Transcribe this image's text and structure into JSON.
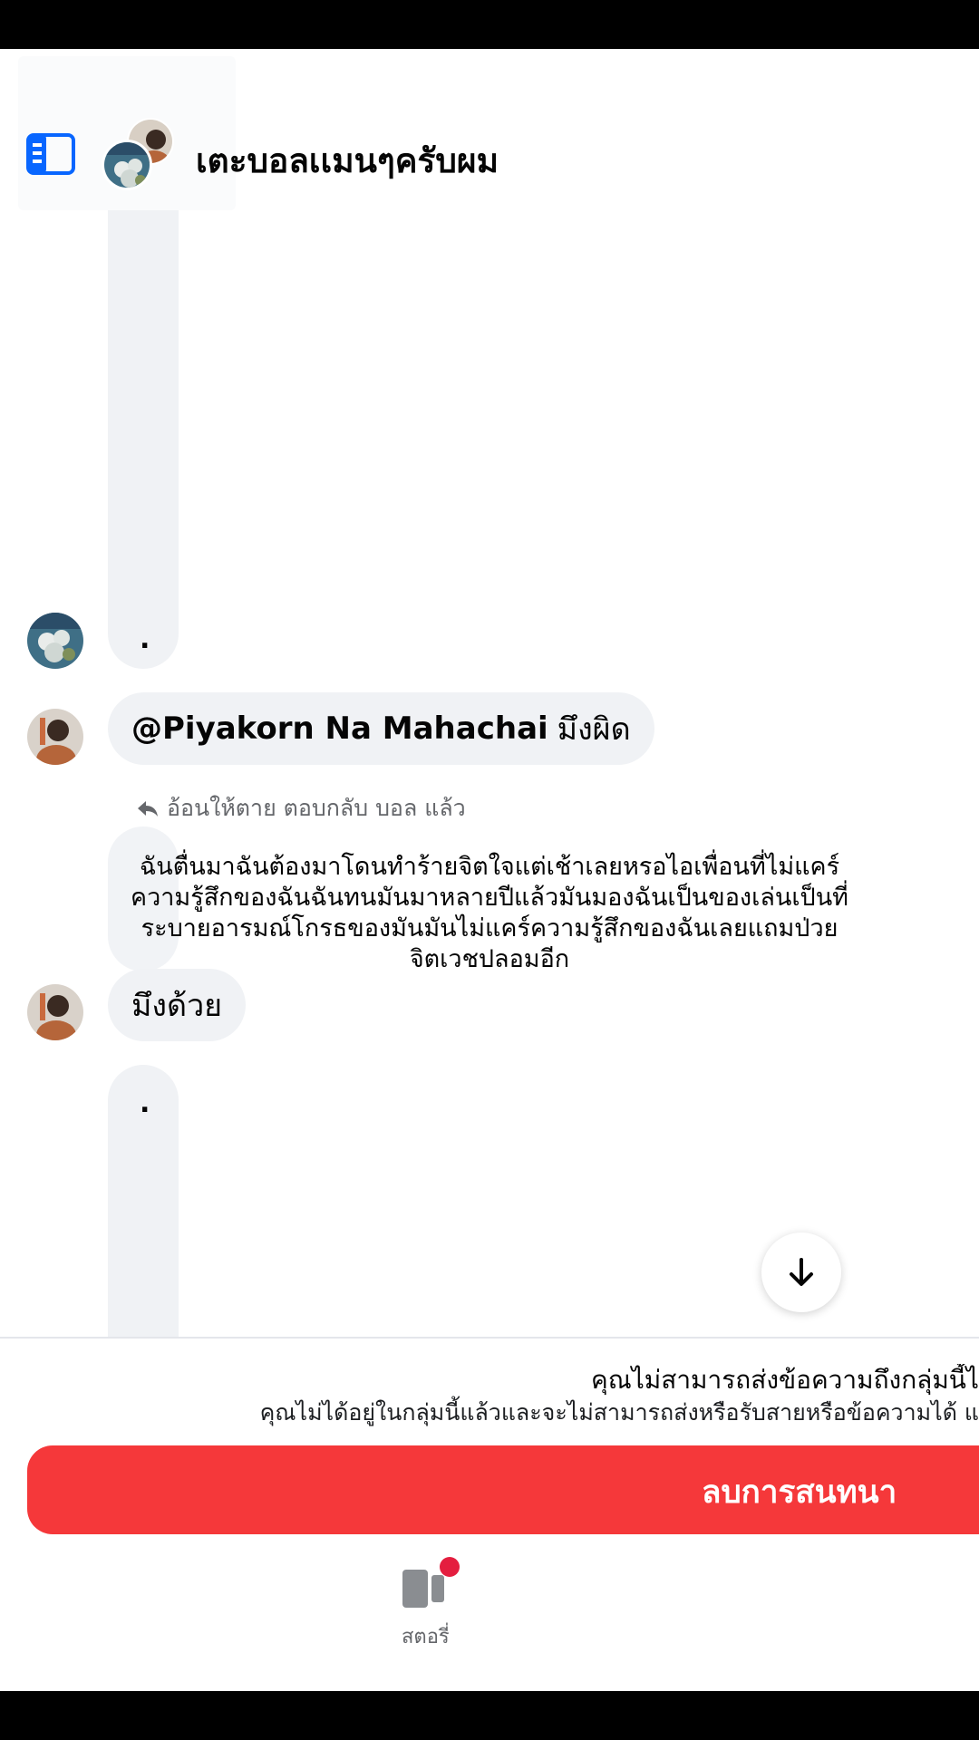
{
  "header": {
    "group_name": "เตะบอลเเมนๆครับผม"
  },
  "messages": {
    "rail_dot_1": ".",
    "mention_bubble": {
      "mention": "@Piyakorn Na Mahachai",
      "text": "มึงผิด"
    },
    "reply_info": "อ้อนให้ตาย ตอบกลับ บอล แล้ว",
    "quoted_text": "ฉันตื่นมาฉันต้องมาโดนทำร้ายจิตใจแต่เช้าเลยหรอไอเพื่อนที่ไม่แคร์ความรู้สึกของฉันฉันทนมันมาหลายปีแล้วมันมองฉันเป็นของเล่นเป็นที่ระบายอารมณ์โกรธของมันมันไม่แคร์ความรู้สึกของฉันเลยแถมป่วยจิตเวชปลอมอีก",
    "reply_bubble": "มึงด้วย",
    "rail_dot_2": "."
  },
  "notice": {
    "line1": "คุณไม่สามารถส่งข้อความถึงกลุ่มนี้ไ",
    "line2": "คุณไม่ได้อยู่ในกลุ่มนี้แล้วและจะไม่สามารถส่งหรือรับสายหรือข้อความได้ แ"
  },
  "actions": {
    "delete_label": "ลบการสนทนา"
  },
  "bottom_nav": {
    "story_label": "สตอรี่"
  },
  "colors": {
    "delete_button": "#f5383a",
    "bubble": "#f0f2f5",
    "accent_blue": "#0866ff",
    "badge": "#e41e3f"
  },
  "icons": [
    "sidebar-toggle-icon",
    "reply-arrow-icon",
    "arrow-down-icon",
    "stories-icon"
  ]
}
